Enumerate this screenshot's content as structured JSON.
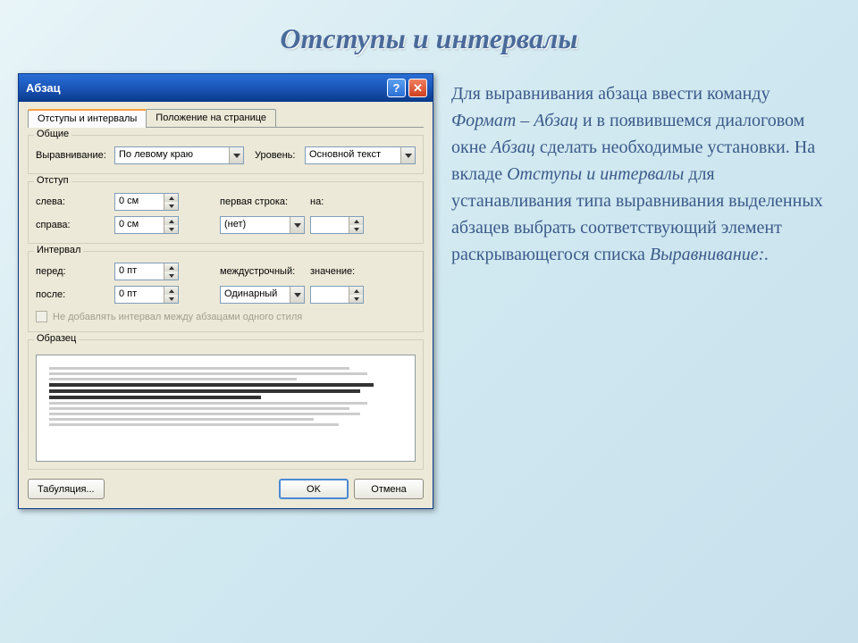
{
  "slide": {
    "title": "Отступы и интервалы"
  },
  "dialog": {
    "title": "Абзац",
    "tabs": {
      "indents": "Отступы и интервалы",
      "position": "Положение на странице"
    },
    "general": {
      "group": "Общие",
      "align_label": "Выравнивание:",
      "align_value": "По левому краю",
      "level_label": "Уровень:",
      "level_value": "Основной текст"
    },
    "indent": {
      "group": "Отступ",
      "left_label": "слева:",
      "left_value": "0 см",
      "right_label": "справа:",
      "right_value": "0 см",
      "firstline_label": "первая строка:",
      "firstline_value": "(нет)",
      "by_label": "на:",
      "by_value": ""
    },
    "spacing": {
      "group": "Интервал",
      "before_label": "перед:",
      "before_value": "0 пт",
      "after_label": "после:",
      "after_value": "0 пт",
      "line_label": "междустрочный:",
      "line_value": "Одинарный",
      "at_label": "значение:",
      "at_value": "",
      "noadd": "Не добавлять интервал между абзацами одного стиля"
    },
    "preview": {
      "group": "Образец"
    },
    "buttons": {
      "tabs": "Табуляция...",
      "ok": "OK",
      "cancel": "Отмена"
    }
  },
  "side": {
    "p1a": "Для выравнивания абзаца ввести команду ",
    "p1b": "Формат – Абзац",
    "p1c": " и в появившемся диалоговом окне ",
    "p1d": "Абзац",
    "p1e": " сделать необходимые установки. На вкладе ",
    "p1f": "Отступы и интервалы",
    "p1g": " для устанавливания типа выравнивания выделенных абзацев выбрать соответствующий элемент раскрывающегося списка ",
    "p1h": "Выравнивание:."
  }
}
